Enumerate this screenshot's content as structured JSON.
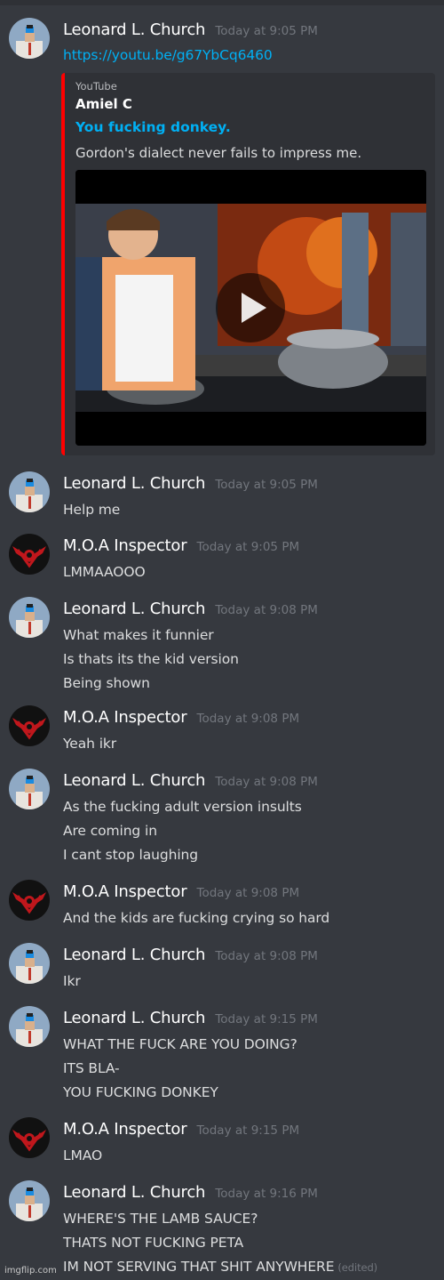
{
  "users": {
    "leonard": "Leonard L. Church",
    "moa": "M.O.A Inspector"
  },
  "messages": [
    {
      "author": "Leonard L. Church",
      "time": "Today at 9:05 PM",
      "lines": [
        "https://youtu.be/g67YbCq6460"
      ]
    },
    {
      "author": "Leonard L. Church",
      "time": "Today at 9:05 PM",
      "lines": [
        "Help me"
      ]
    },
    {
      "author": "M.O.A Inspector",
      "time": "Today at 9:05 PM",
      "lines": [
        "LMMAAOOO"
      ]
    },
    {
      "author": "Leonard L. Church",
      "time": "Today at 9:08 PM",
      "lines": [
        "What makes it funnier",
        "Is thats its the kid version",
        "Being shown"
      ]
    },
    {
      "author": "M.O.A Inspector",
      "time": "Today at 9:08 PM",
      "lines": [
        "Yeah ikr"
      ]
    },
    {
      "author": "Leonard L. Church",
      "time": "Today at 9:08 PM",
      "lines": [
        "As the fucking adult version insults",
        "Are coming in",
        "I cant stop laughing"
      ]
    },
    {
      "author": "M.O.A Inspector",
      "time": "Today at 9:08 PM",
      "lines": [
        "And the kids are fucking crying so hard"
      ]
    },
    {
      "author": "Leonard L. Church",
      "time": "Today at 9:08 PM",
      "lines": [
        "Ikr"
      ]
    },
    {
      "author": "Leonard L. Church",
      "time": "Today at 9:15 PM",
      "lines": [
        "WHAT THE FUCK ARE YOU DOING?",
        "ITS BLA-",
        "YOU FUCKING DONKEY"
      ]
    },
    {
      "author": "M.O.A Inspector",
      "time": "Today at 9:15 PM",
      "lines": [
        "LMAO"
      ]
    },
    {
      "author": "Leonard L. Church",
      "time": "Today at 9:16 PM",
      "lines": [
        "WHERE'S THE LAMB SAUCE?",
        "THATS NOT FUCKING PETA",
        "IM NOT SERVING THAT SHIT ANYWHERE"
      ],
      "edited": "(edited)"
    }
  ],
  "embed": {
    "provider": "YouTube",
    "author": "Amiel C",
    "title": "You fucking donkey.",
    "description": "Gordon's dialect never fails to impress me.",
    "accent_color": "#ff0000",
    "video_thumbnail": "kid-cooking-scene"
  },
  "colors": {
    "background": "#36393f",
    "link": "#00b0f4",
    "timestamp": "#72767d",
    "username": "#ffffff",
    "embed_bg": "#2f3136"
  },
  "watermark": "imgflip.com"
}
